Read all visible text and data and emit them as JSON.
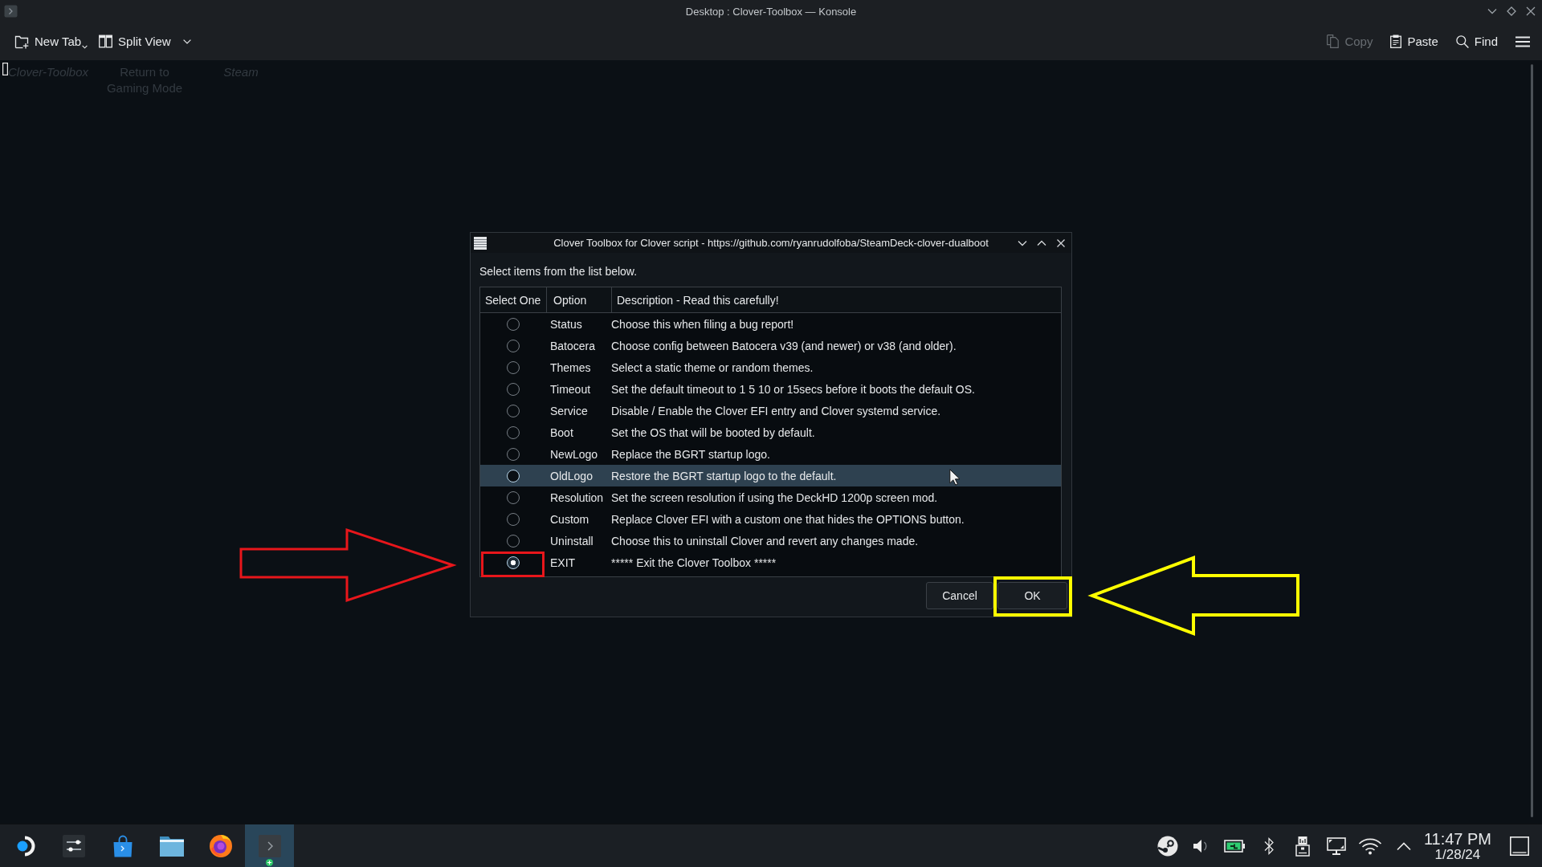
{
  "window": {
    "title": "Desktop : Clover-Toolbox — Konsole"
  },
  "toolbar": {
    "left": [
      {
        "kind": "new-tab",
        "label": "New Tab",
        "disabled": false
      },
      {
        "kind": "split-view",
        "label": "Split View",
        "disabled": false
      }
    ],
    "right": [
      {
        "kind": "copy",
        "label": "Copy",
        "disabled": true
      },
      {
        "kind": "paste",
        "label": "Paste",
        "disabled": false
      },
      {
        "kind": "find",
        "label": "Find",
        "disabled": false
      }
    ]
  },
  "terminal": {
    "desktop_labels": [
      {
        "text": "Clover-Toolbox",
        "italic": true
      },
      {
        "text": "Return to Gaming Mode",
        "italic": false
      },
      {
        "text": "Steam",
        "italic": true
      }
    ]
  },
  "dialog": {
    "title": "Clover Toolbox for Clover script - https://github.com/ryanrudolfoba/SteamDeck-clover-dualboot",
    "prompt": "Select items from the list below.",
    "columns": [
      "Select One",
      "Option",
      "Description - Read this carefully!"
    ],
    "rows": [
      {
        "option": "Status",
        "description": "Choose this when filing a bug report!",
        "checked": false,
        "selected": false,
        "boxed": false
      },
      {
        "option": "Batocera",
        "description": "Choose config between Batocera v39 (and newer) or v38 (and older).",
        "checked": false,
        "selected": false,
        "boxed": false
      },
      {
        "option": "Themes",
        "description": "Select a static theme or random themes.",
        "checked": false,
        "selected": false,
        "boxed": false
      },
      {
        "option": "Timeout",
        "description": "Set the default timeout to 1 5 10 or 15secs before it boots the default OS.",
        "checked": false,
        "selected": false,
        "boxed": false
      },
      {
        "option": "Service",
        "description": "Disable / Enable the Clover EFI entry and Clover systemd service.",
        "checked": false,
        "selected": false,
        "boxed": false
      },
      {
        "option": "Boot",
        "description": "Set the OS that will be booted by default.",
        "checked": false,
        "selected": false,
        "boxed": false
      },
      {
        "option": "NewLogo",
        "description": "Replace the BGRT startup logo.",
        "checked": false,
        "selected": false,
        "boxed": false
      },
      {
        "option": "OldLogo",
        "description": "Restore the BGRT startup logo to the default.",
        "checked": false,
        "selected": true,
        "boxed": false
      },
      {
        "option": "Resolution",
        "description": "Set the screen resolution if using the DeckHD 1200p screen mod.",
        "checked": false,
        "selected": false,
        "boxed": false
      },
      {
        "option": "Custom",
        "description": "Replace Clover EFI with a custom one that hides the OPTIONS button.",
        "checked": false,
        "selected": false,
        "boxed": false
      },
      {
        "option": "Uninstall",
        "description": "Choose this to uninstall Clover and revert any changes made.",
        "checked": false,
        "selected": false,
        "boxed": false
      },
      {
        "option": "EXIT",
        "description": "***** Exit the Clover Toolbox *****",
        "checked": true,
        "selected": false,
        "boxed": true
      }
    ],
    "buttons": [
      {
        "label": "Cancel",
        "boxed": false
      },
      {
        "label": "OK",
        "boxed": true
      }
    ]
  },
  "annotations": [
    {
      "kind": "arrow-right",
      "color": "#e8161b"
    },
    {
      "kind": "arrow-left",
      "color": "#ffff00"
    }
  ],
  "taskbar": {
    "apps": [
      {
        "kind": "launcher",
        "active": false
      },
      {
        "kind": "settings",
        "active": false
      },
      {
        "kind": "store",
        "active": false
      },
      {
        "kind": "files",
        "active": false
      },
      {
        "kind": "browser",
        "active": false
      },
      {
        "kind": "terminal",
        "active": true
      }
    ],
    "tray": [
      {
        "kind": "client"
      },
      {
        "kind": "volume"
      },
      {
        "kind": "battery"
      },
      {
        "kind": "bluetooth"
      },
      {
        "kind": "storage"
      },
      {
        "kind": "display"
      },
      {
        "kind": "wifi"
      },
      {
        "kind": "expand"
      }
    ],
    "clock": {
      "time": "11:47 PM",
      "date": "1/28/24"
    }
  }
}
